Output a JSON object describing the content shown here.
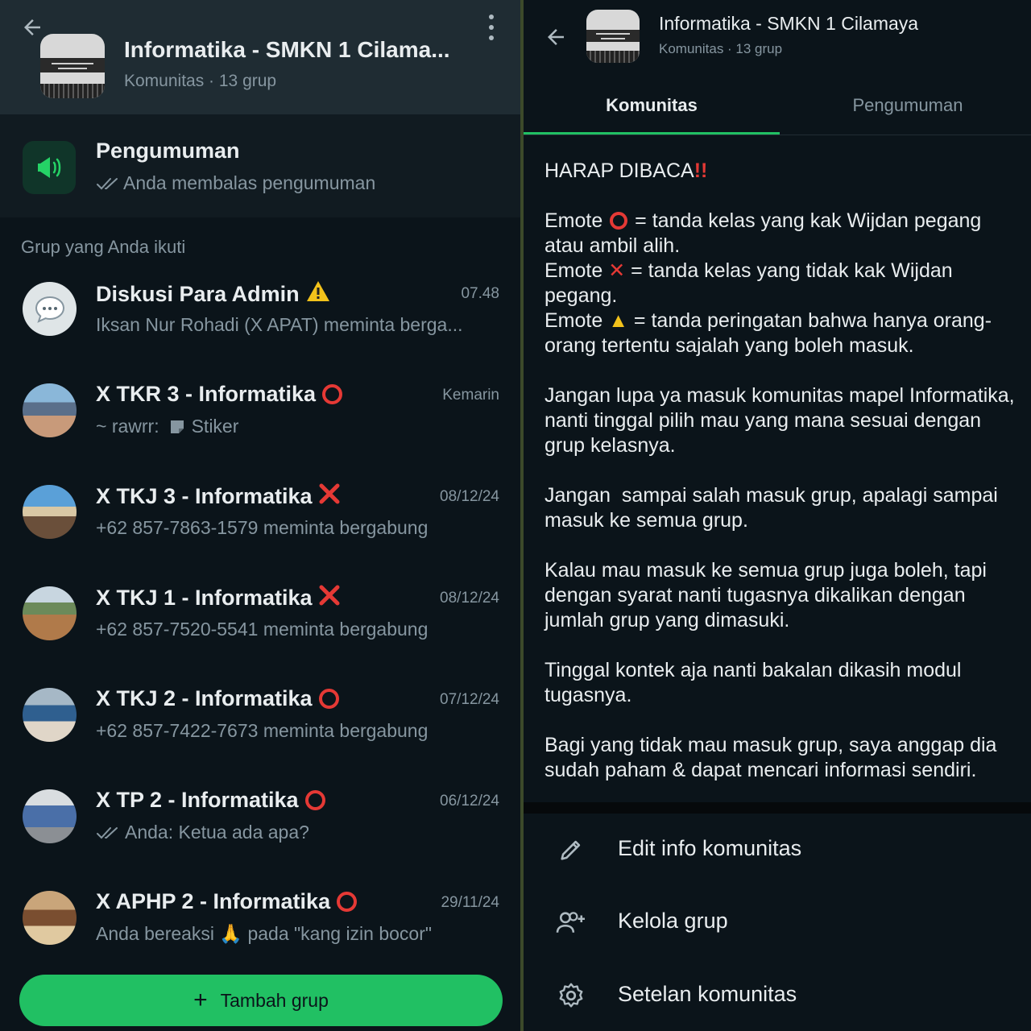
{
  "left": {
    "header": {
      "title": "Informatika - SMKN 1 Cilama...",
      "subtitle": "Komunitas · 13 grup",
      "back_icon": "arrow-left-icon",
      "menu_icon": "kebab-menu-icon"
    },
    "announcement": {
      "title": "Pengumuman",
      "subtitle": "Anda membalas pengumuman",
      "icon": "megaphone-icon"
    },
    "section_label": "Grup yang Anda ikuti",
    "groups": [
      {
        "name": "Diskusi Para Admin",
        "emoji": "⚠️",
        "time": "07.48",
        "message": "Iksan Nur Rohadi (X APAT) meminta berga..."
      },
      {
        "name": "X TKR 3 - Informatika",
        "emoji": "⭕",
        "time": "Kemarin",
        "message_prefix": "~ rawrr:",
        "message": "Stiker"
      },
      {
        "name": "X TKJ 3 - Informatika",
        "emoji": "❌",
        "time": "08/12/24",
        "message": "+62 857-7863-1579 meminta bergabung"
      },
      {
        "name": "X TKJ 1 - Informatika",
        "emoji": "❌",
        "time": "08/12/24",
        "message": "+62 857-7520-5541 meminta bergabung"
      },
      {
        "name": "X TKJ 2 - Informatika",
        "emoji": "⭕",
        "time": "07/12/24",
        "message": "+62 857-7422-7673 meminta bergabung"
      },
      {
        "name": "X TP 2 - Informatika",
        "emoji": "⭕",
        "time": "06/12/24",
        "message": "Anda: Ketua ada apa?"
      },
      {
        "name": "X APHP 2 - Informatika",
        "emoji": "⭕",
        "time": "29/11/24",
        "message": "Anda bereaksi 🙏 pada \"kang izin bocor\""
      }
    ],
    "add_button": {
      "label": "Tambah grup"
    }
  },
  "right": {
    "header": {
      "title": "Informatika - SMKN 1 Cilamaya",
      "subtitle": "Komunitas · 13 grup"
    },
    "tabs": [
      {
        "label": "Komunitas",
        "active": true
      },
      {
        "label": "Pengumuman",
        "active": false
      }
    ],
    "description": {
      "heading": "HARAP DIBACA",
      "heading_emoji": "‼️",
      "lines": [
        {
          "prefix": "Emote",
          "emoji": "⭕",
          "text": "= tanda kelas yang kak Wijdan pegang atau ambil alih."
        },
        {
          "prefix": "Emote",
          "emoji": "❌",
          "text": "= tanda kelas yang tidak kak Wijdan pegang."
        },
        {
          "prefix": "Emote",
          "emoji": "⚠️",
          "text": "= tanda peringatan bahwa hanya orang-orang tertentu sajalah yang boleh masuk."
        }
      ],
      "paragraphs": [
        "Jangan lupa ya masuk komunitas mapel Informatika, nanti tinggal pilih mau yang mana sesuai dengan grup kelasnya.",
        "Jangan  sampai salah masuk grup, apalagi sampai masuk ke semua grup.",
        "Kalau mau masuk ke semua grup juga boleh, tapi dengan syarat nanti tugasnya dikalikan dengan jumlah grup yang dimasuki.",
        "Tinggal kontek aja nanti bakalan dikasih modul tugasnya.",
        "Bagi yang tidak mau masuk grup, saya anggap dia sudah paham & dapat mencari informasi sendiri."
      ]
    },
    "actions": [
      {
        "label": "Edit info komunitas",
        "icon": "pencil-icon"
      },
      {
        "label": "Kelola grup",
        "icon": "manage-groups-icon"
      },
      {
        "label": "Setelan komunitas",
        "icon": "gear-icon"
      }
    ],
    "colors": {
      "accent": "#21c063",
      "background": "#0b141a",
      "secondary_text": "#8696a0",
      "alert_red": "#e53935"
    }
  }
}
